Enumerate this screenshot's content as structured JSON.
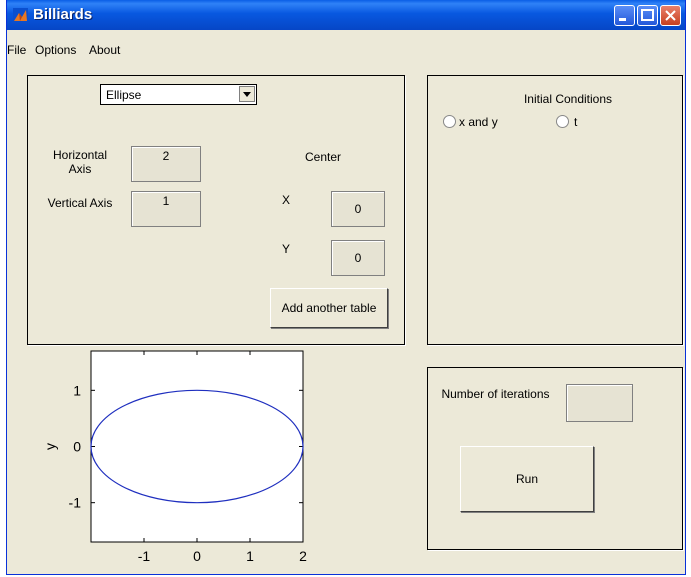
{
  "window": {
    "title": "Billiards"
  },
  "menu": [
    "File",
    "Options",
    "About"
  ],
  "table_panel": {
    "shape_select": "Ellipse",
    "horizontal_axis_label": "Horizontal\nAxis",
    "horizontal_axis_value": "2",
    "vertical_axis_label": "Vertical Axis",
    "vertical_axis_value": "1",
    "center_label": "Center",
    "x_label": "X",
    "x_value": "0",
    "y_label": "Y",
    "y_value": "0",
    "add_button": "Add another table"
  },
  "initial_conditions": {
    "title": "Initial Conditions",
    "options": [
      "x and y",
      "t"
    ],
    "selected": null
  },
  "run_panel": {
    "iterations_label": "Number of iterations",
    "iterations_value": "",
    "run_button": "Run"
  },
  "colors": {
    "curve": "#1f2fbf",
    "titlebar": "#0858e0"
  },
  "chart_data": {
    "type": "line",
    "series": [
      {
        "shape": "ellipse",
        "center": [
          0,
          0
        ],
        "semi_axes": [
          2,
          1
        ]
      }
    ],
    "xlim": [
      -2,
      2
    ],
    "ylim": [
      -1.7,
      1.7
    ],
    "xticks": [
      -1,
      0,
      1,
      2
    ],
    "yticks": [
      -1,
      0,
      1
    ],
    "xlabel": "",
    "ylabel": "y",
    "grid": false
  }
}
